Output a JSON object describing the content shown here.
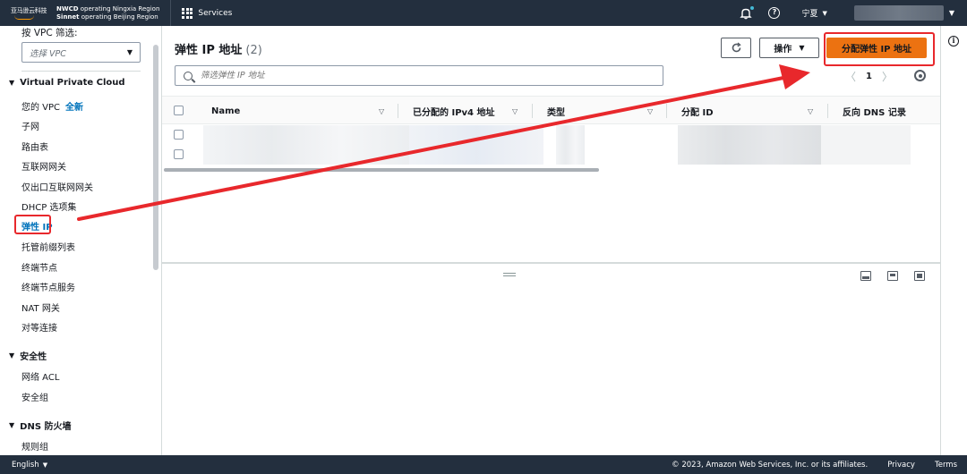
{
  "topnav": {
    "logo_text": "亚马逊云科技",
    "operator_line1_bold": "NWCD",
    "operator_line1": " operating Ningxia Region",
    "operator_line2_bold": "Sinnet",
    "operator_line2": " operating Beijing Region",
    "services_label": "Services",
    "region_label": "宁夏"
  },
  "sidebar": {
    "filter_label": "按 VPC 筛选:",
    "vpc_select_placeholder": "选择 VPC",
    "sections": [
      {
        "title": "Virtual Private Cloud"
      },
      {
        "title": "安全性"
      },
      {
        "title": "DNS 防火墙"
      }
    ],
    "vpc_items": [
      {
        "label": "您的 VPC",
        "tag": "全新"
      },
      {
        "label": "子网"
      },
      {
        "label": "路由表"
      },
      {
        "label": "互联网网关"
      },
      {
        "label": "仅出口互联网网关"
      },
      {
        "label": "DHCP 选项集"
      },
      {
        "label": "弹性 IP",
        "active": true
      },
      {
        "label": "托管前缀列表"
      },
      {
        "label": "终端节点"
      },
      {
        "label": "终端节点服务"
      },
      {
        "label": "NAT 网关"
      },
      {
        "label": "对等连接"
      }
    ],
    "security_items": [
      {
        "label": "网络 ACL"
      },
      {
        "label": "安全组"
      }
    ],
    "dns_items": [
      {
        "label": "规则组"
      }
    ]
  },
  "main": {
    "title": "弹性 IP 地址",
    "count": "(2)",
    "actions_label": "操作",
    "primary_label": "分配弹性 IP 地址",
    "search_placeholder": "筛选弹性 IP 地址",
    "page_number": "1",
    "columns": [
      "Name",
      "已分配的 IPv4 地址",
      "类型",
      "分配 ID",
      "反向 DNS 记录"
    ],
    "row_count": 2
  },
  "footer": {
    "language": "English",
    "copyright": "© 2023, Amazon Web Services, Inc. or its affiliates.",
    "privacy": "Privacy",
    "terms": "Terms"
  },
  "colors": {
    "nav_bg": "#232f3e",
    "primary": "#ec7211",
    "link": "#0073bb",
    "annotation": "#e8282c"
  },
  "icons": [
    "grid-icon",
    "bell-icon",
    "help-icon",
    "refresh-icon",
    "search-icon",
    "settings-icon",
    "info-icon",
    "layout-icon"
  ]
}
